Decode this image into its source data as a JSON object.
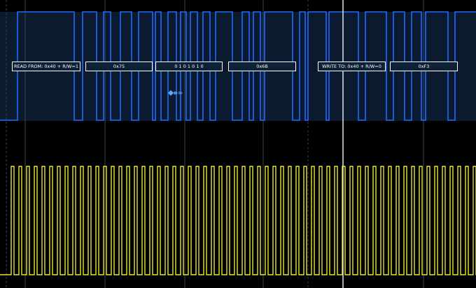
{
  "colors": {
    "background": "#000000",
    "sda_trace": "#1f6bff",
    "scl_trace": "#e8e62a",
    "sda_band": "#0b1a2e",
    "grid": "#3a4450",
    "decode_box_fill": "#0d2238",
    "decode_box_border": "#ffffff",
    "cursor": "#e6e6e6",
    "trigger_marker": "#5aa8ff"
  },
  "decode": {
    "read_address": "READ FROM: 0x40 + R/W=1",
    "byte_1": "0x75",
    "bits": "0  1  0  1  0  1  0",
    "byte_2": "0x6B",
    "write_address": "WRITE TO: 0x40 + R/W=0",
    "byte_3": "0xF3"
  },
  "icons": {
    "trigger_marker": "diamond-arrows-icon"
  }
}
